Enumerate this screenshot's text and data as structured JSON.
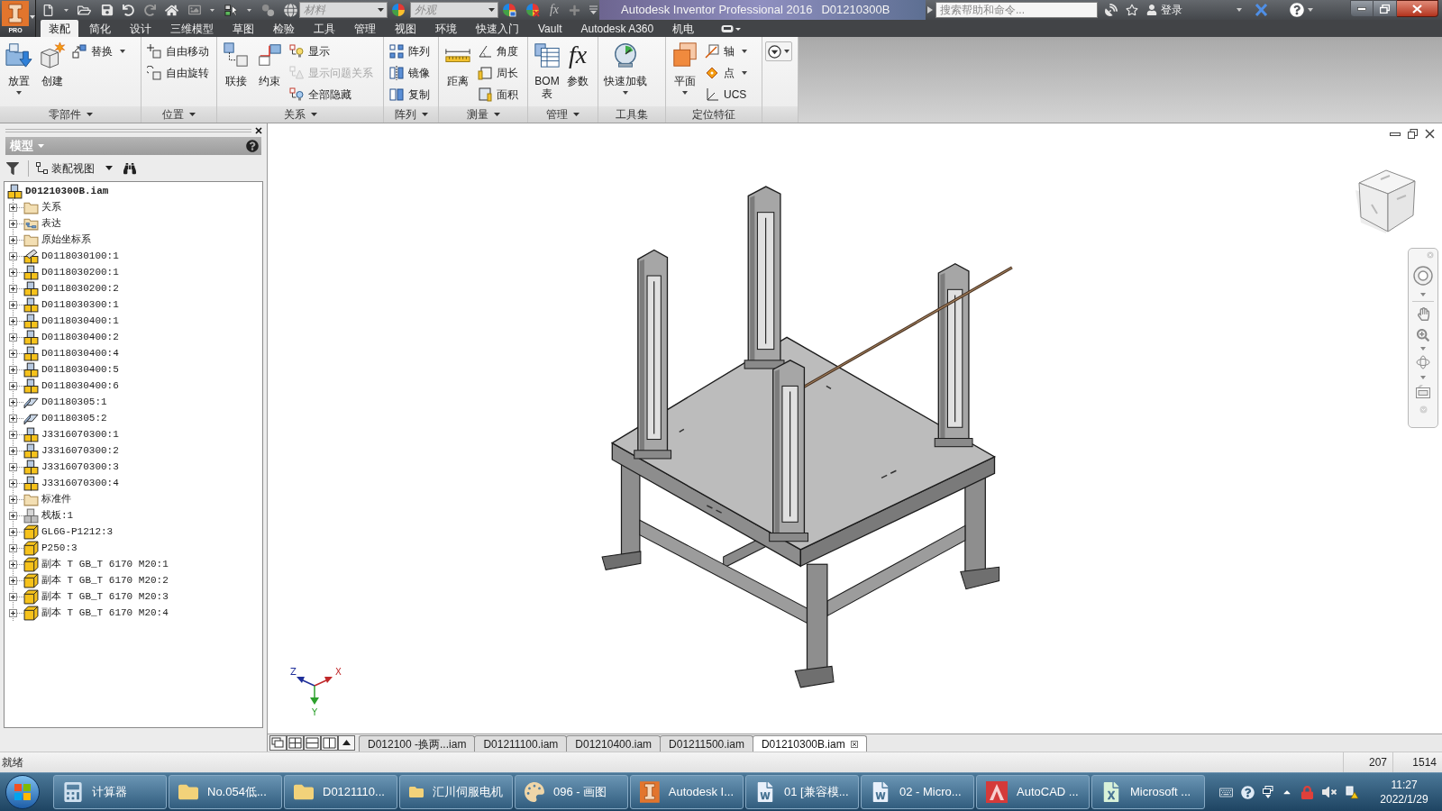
{
  "title_bar": {
    "app_badge": "PRO",
    "material": {
      "placeholder": "材料"
    },
    "appearance": {
      "placeholder": "外观"
    },
    "function_glyph": "fx",
    "app_name": "Autodesk Inventor Professional 2016",
    "document": "D01210300B",
    "search": {
      "placeholder": "搜索帮助和命令..."
    },
    "sign_in": "登录"
  },
  "menu_tabs": [
    {
      "label": "装配",
      "selected": true
    },
    {
      "label": "简化",
      "selected": false
    },
    {
      "label": "设计",
      "selected": false
    },
    {
      "label": "三维模型",
      "selected": false
    },
    {
      "label": "草图",
      "selected": false
    },
    {
      "label": "检验",
      "selected": false
    },
    {
      "label": "工具",
      "selected": false
    },
    {
      "label": "管理",
      "selected": false
    },
    {
      "label": "视图",
      "selected": false
    },
    {
      "label": "环境",
      "selected": false
    },
    {
      "label": "快速入门",
      "selected": false
    },
    {
      "label": "Vault",
      "selected": false
    },
    {
      "label": "Autodesk A360",
      "selected": false
    },
    {
      "label": "机电",
      "selected": false
    }
  ],
  "ribbon": {
    "panels": [
      {
        "title": "零部件",
        "menu": true,
        "columns": [
          {
            "kind": "large",
            "label": "放置",
            "dropdown": true
          },
          {
            "kind": "large",
            "label": "创建",
            "dropdown": false
          },
          {
            "kind": "stack",
            "items": [
              {
                "label": "替换",
                "dropdown": true,
                "disabled": false
              }
            ]
          }
        ]
      },
      {
        "title": "位置",
        "menu": true,
        "columns": [
          {
            "kind": "stack",
            "items": [
              {
                "label": "自由移动",
                "dropdown": false,
                "disabled": false
              },
              {
                "label": "自由旋转",
                "dropdown": false,
                "disabled": false
              }
            ]
          }
        ]
      },
      {
        "title": "关系",
        "menu": true,
        "columns": [
          {
            "kind": "large",
            "label": "联接",
            "dropdown": false
          },
          {
            "kind": "large",
            "label": "约束",
            "dropdown": false
          },
          {
            "kind": "stack",
            "items": [
              {
                "label": "显示",
                "dropdown": false,
                "disabled": false
              },
              {
                "label": "显示问题关系",
                "dropdown": false,
                "disabled": true
              },
              {
                "label": "全部隐藏",
                "dropdown": false,
                "disabled": false
              }
            ]
          }
        ]
      },
      {
        "title": "阵列",
        "menu": true,
        "columns": [
          {
            "kind": "stack",
            "items": [
              {
                "label": "阵列",
                "dropdown": false,
                "disabled": false
              },
              {
                "label": "镜像",
                "dropdown": false,
                "disabled": false
              },
              {
                "label": "复制",
                "dropdown": false,
                "disabled": false
              }
            ]
          }
        ]
      },
      {
        "title": "测量",
        "menu": true,
        "columns": [
          {
            "kind": "large",
            "label": "距离",
            "dropdown": false
          },
          {
            "kind": "stack",
            "items": [
              {
                "label": "角度",
                "dropdown": false,
                "disabled": false
              },
              {
                "label": "周长",
                "dropdown": false,
                "disabled": false
              },
              {
                "label": "面积",
                "dropdown": false,
                "disabled": false
              }
            ]
          }
        ]
      },
      {
        "title": "管理",
        "menu": true,
        "columns": [
          {
            "kind": "large",
            "label": "BOM\n表",
            "dropdown": false
          },
          {
            "kind": "large",
            "label": "参数",
            "glyph": "fx",
            "dropdown": false
          }
        ]
      },
      {
        "title": "工具集",
        "menu": false,
        "columns": [
          {
            "kind": "large",
            "label": "快速加载",
            "dropdown": true
          }
        ]
      },
      {
        "title": "定位特征",
        "menu": false,
        "columns": [
          {
            "kind": "large",
            "label": "平面",
            "dropdown": true
          },
          {
            "kind": "stack",
            "items": [
              {
                "label": "轴",
                "dropdown": true,
                "disabled": false
              },
              {
                "label": "点",
                "dropdown": true,
                "disabled": false
              },
              {
                "label": "UCS",
                "dropdown": false,
                "disabled": false
              }
            ]
          }
        ]
      },
      {
        "columns": [
          {
            "kind": "icon",
            "dropdown": true
          }
        ]
      }
    ]
  },
  "browser": {
    "title": "模型",
    "view_mode": "装配视图",
    "tree": {
      "label": "D01210300B.iam",
      "kind": "assembly",
      "children": [
        {
          "label": "关系",
          "kind": "folder",
          "expanded": false
        },
        {
          "label": "表达",
          "kind": "representations",
          "expanded": false
        },
        {
          "label": "原始坐标系",
          "kind": "folder",
          "expanded": false
        },
        {
          "label": "D0118030100:1",
          "kind": "edited-assembly",
          "expanded": false
        },
        {
          "label": "D0118030200:1",
          "kind": "assembly",
          "expanded": false
        },
        {
          "label": "D0118030200:2",
          "kind": "assembly",
          "expanded": false
        },
        {
          "label": "D0118030300:1",
          "kind": "assembly",
          "expanded": false
        },
        {
          "label": "D0118030400:1",
          "kind": "assembly",
          "expanded": false
        },
        {
          "label": "D0118030400:2",
          "kind": "assembly",
          "expanded": false
        },
        {
          "label": "D0118030400:4",
          "kind": "assembly",
          "expanded": false
        },
        {
          "label": "D0118030400:5",
          "kind": "assembly",
          "expanded": false
        },
        {
          "label": "D0118030400:6",
          "kind": "assembly",
          "expanded": false
        },
        {
          "label": "D01180305:1",
          "kind": "profile",
          "expanded": false
        },
        {
          "label": "D01180305:2",
          "kind": "profile",
          "expanded": false
        },
        {
          "label": "J3316070300:1",
          "kind": "assembly",
          "expanded": false
        },
        {
          "label": "J3316070300:2",
          "kind": "assembly",
          "expanded": false
        },
        {
          "label": "J3316070300:3",
          "kind": "assembly",
          "expanded": false
        },
        {
          "label": "J3316070300:4",
          "kind": "assembly",
          "expanded": false
        },
        {
          "label": "标准件",
          "kind": "folder",
          "expanded": false
        },
        {
          "label": "栈板:1",
          "kind": "substitute",
          "expanded": false
        },
        {
          "label": "GL6G-P1212:3",
          "kind": "part",
          "expanded": false
        },
        {
          "label": "P250:3",
          "kind": "part",
          "expanded": false
        },
        {
          "label": "副本 T GB_T 6170 M20:1",
          "kind": "part",
          "expanded": false
        },
        {
          "label": "副本 T GB_T 6170 M20:2",
          "kind": "part",
          "expanded": false
        },
        {
          "label": "副本 T GB_T 6170 M20:3",
          "kind": "part",
          "expanded": false
        },
        {
          "label": "副本 T GB_T 6170 M20:4",
          "kind": "part",
          "expanded": false
        }
      ]
    }
  },
  "viewport": {
    "axis_triad": {
      "x": "X",
      "y": "Y",
      "z": "Z"
    }
  },
  "document_tabs": [
    {
      "label": "D012100 -换两...iam",
      "selected": false
    },
    {
      "label": "D01211100.iam",
      "selected": false
    },
    {
      "label": "D01210400.iam",
      "selected": false
    },
    {
      "label": "D01211500.iam",
      "selected": false
    },
    {
      "label": "D01210300B.iam",
      "selected": true
    }
  ],
  "status_bar": {
    "message": "就绪",
    "fields": [
      "207",
      "1514"
    ]
  },
  "taskbar": {
    "items": [
      "计算器",
      "No.054低...",
      "D0121110...",
      "汇川伺服电机",
      "096 - 画图",
      "Autodesk I...",
      "01 [兼容模...",
      "02 - Micro...",
      "AutoCAD ...",
      "Microsoft ..."
    ],
    "clock": {
      "time": "11:27",
      "date": "2022/1/29"
    }
  }
}
